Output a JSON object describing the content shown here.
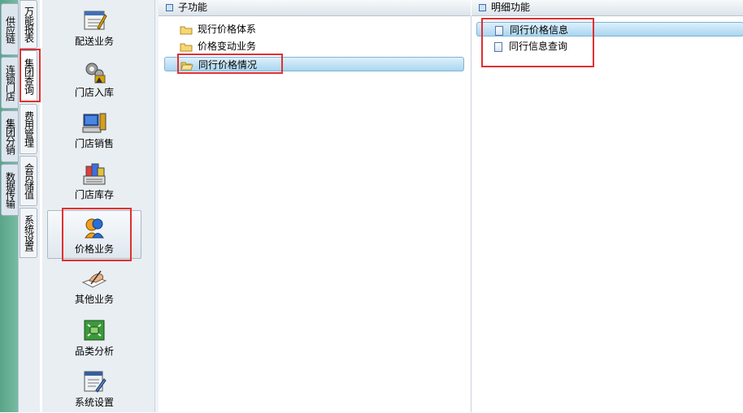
{
  "nav_tabs_col1": [
    {
      "label": "供应链"
    },
    {
      "label": "连锁门店"
    },
    {
      "label": "集团分销"
    },
    {
      "label": "数据传输"
    }
  ],
  "nav_tabs_col2": [
    {
      "label": "万能报表"
    },
    {
      "label": "集团查询"
    },
    {
      "label": "费用管理"
    },
    {
      "label": "会员储值"
    },
    {
      "label": "系统设置"
    }
  ],
  "modules": [
    {
      "label": "配送业务",
      "icon": "delivery-icon"
    },
    {
      "label": "门店入库",
      "icon": "gear-stock-in-icon"
    },
    {
      "label": "门店销售",
      "icon": "pos-terminal-icon"
    },
    {
      "label": "门店库存",
      "icon": "inventory-icon"
    },
    {
      "label": "价格业务",
      "icon": "price-person-icon",
      "selected": true
    },
    {
      "label": "其他业务",
      "icon": "hand-writing-icon"
    },
    {
      "label": "品类分析",
      "icon": "category-analysis-icon"
    },
    {
      "label": "系统设置",
      "icon": "system-settings-icon"
    }
  ],
  "subfunction_panel": {
    "title": "子功能",
    "items": [
      {
        "label": "现行价格体系",
        "icon": "folder-icon"
      },
      {
        "label": "价格变动业务",
        "icon": "folder-icon"
      },
      {
        "label": "同行价格情况",
        "icon": "folder-open-icon",
        "selected": true
      }
    ]
  },
  "detail_panel": {
    "title": "明细功能",
    "items": [
      {
        "label": "同行价格信息",
        "icon": "document-icon",
        "selected": true
      },
      {
        "label": "同行信息查询",
        "icon": "document-icon"
      }
    ]
  },
  "colors": {
    "highlight_box": "#e03030",
    "selection": "#a9d6f0",
    "left_strip": "#6fb39a"
  }
}
